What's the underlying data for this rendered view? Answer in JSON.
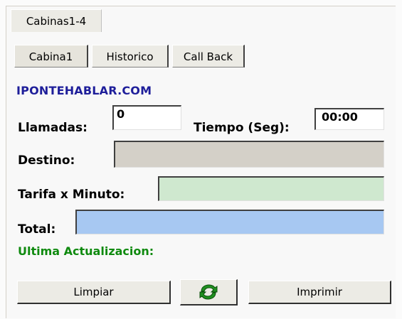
{
  "tabs_outer": [
    {
      "label": "Cabinas1-4"
    }
  ],
  "tabs_inner": [
    {
      "label": "Cabina1",
      "active": true
    },
    {
      "label": "Historico",
      "active": false
    },
    {
      "label": "Call Back",
      "active": false
    }
  ],
  "brand": "IPONTEHABLAR.COM",
  "llamadas": {
    "label": "Llamadas:",
    "value": "0"
  },
  "tiempo": {
    "label": "Tiempo (Seg):",
    "value": "00:00"
  },
  "destino": {
    "label": "Destino:",
    "value": ""
  },
  "tarifa": {
    "label": "Tarifa x Minuto:",
    "value": ""
  },
  "total": {
    "label": "Total:",
    "value": ""
  },
  "ultima": {
    "label": "Ultima Actualizacion:"
  },
  "buttons": {
    "limpiar": "Limpiar",
    "imprimir": "Imprimir",
    "refresh_icon": "refresh-icon"
  },
  "colors": {
    "brand": "#1e1e9a",
    "ultima": "#0f8a0f",
    "destino_bg": "#d4d0c8",
    "tarifa_bg": "#cfe8cf",
    "total_bg": "#a7c8f2",
    "refresh": "#1f8f1f"
  }
}
